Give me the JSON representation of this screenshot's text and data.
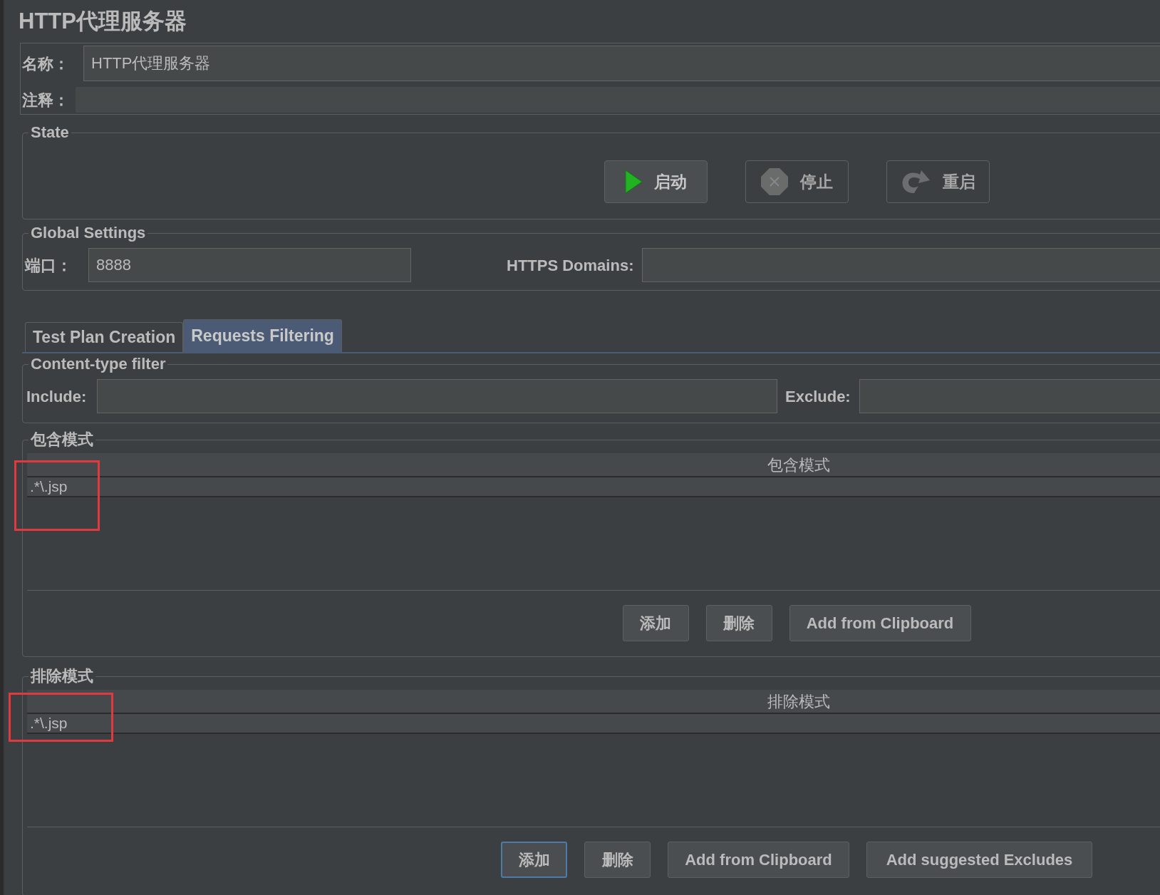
{
  "title": "HTTP代理服务器",
  "name_field": {
    "label": "名称：",
    "value": "HTTP代理服务器"
  },
  "comment_field": {
    "label": "注释："
  },
  "state_group": {
    "title": "State",
    "buttons": [
      {
        "label": "启动",
        "kind": "start",
        "disabled": false
      },
      {
        "label": "停止",
        "kind": "stop",
        "disabled": true
      },
      {
        "label": "重启",
        "kind": "restart",
        "disabled": true
      }
    ]
  },
  "global_settings": {
    "title": "Global Settings",
    "port": {
      "label": "端口：",
      "value": "8888"
    },
    "https_domains": {
      "label": "HTTPS Domains:"
    }
  },
  "tabs": [
    {
      "label": "Test Plan Creation",
      "selected": false
    },
    {
      "label": "Requests Filtering",
      "selected": true
    }
  ],
  "content_type_filter": {
    "title": "Content-type filter",
    "include": {
      "label": "Include:"
    },
    "exclude": {
      "label": "Exclude:"
    }
  },
  "pattern_groups": [
    {
      "title": "包含模式",
      "column": "包含模式",
      "rows": [
        ".*\\.jsp"
      ],
      "highlighted": true,
      "buttons": [
        {
          "label": "添加",
          "focused": false
        },
        {
          "label": "删除",
          "focused": false
        },
        {
          "label": "Add from Clipboard",
          "focused": false
        }
      ]
    },
    {
      "title": "排除模式",
      "column": "排除模式",
      "rows": [
        ".*\\.jsp"
      ],
      "highlighted": true,
      "buttons": [
        {
          "label": "添加",
          "focused": true
        },
        {
          "label": "删除",
          "focused": false
        },
        {
          "label": "Add from Clipboard",
          "focused": false
        },
        {
          "label": "Add suggested Excludes",
          "focused": false
        }
      ]
    }
  ]
}
